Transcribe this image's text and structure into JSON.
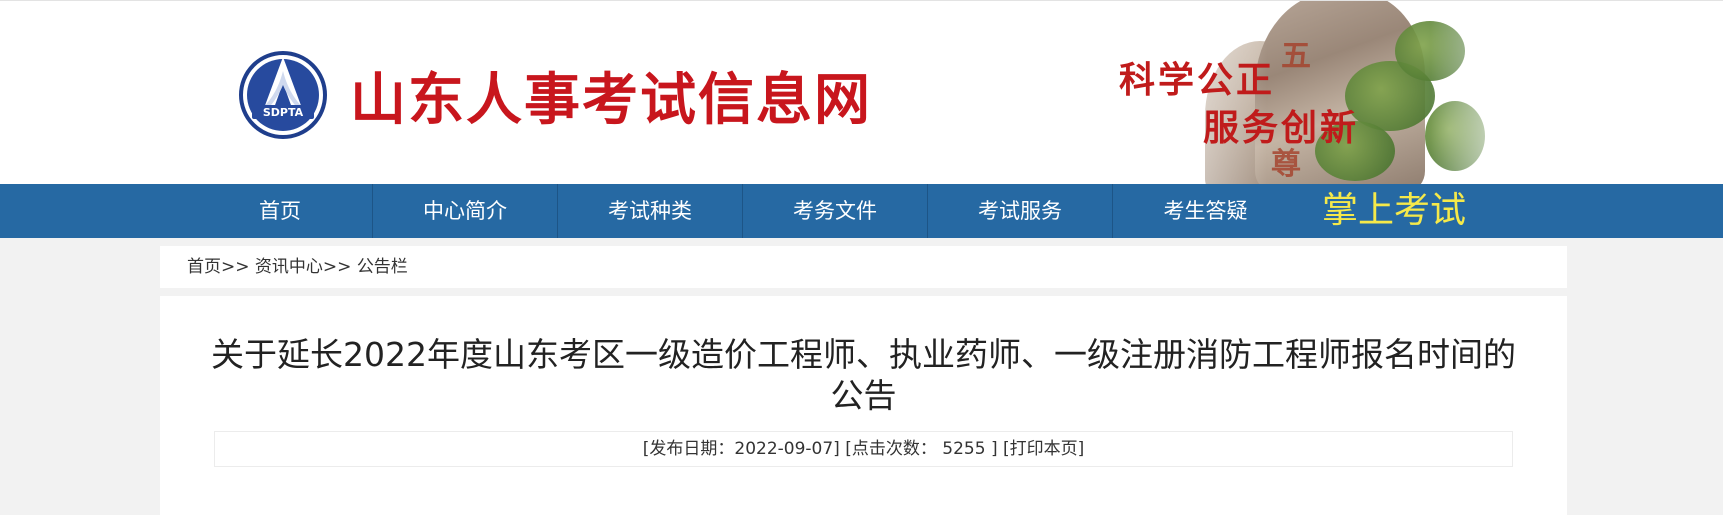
{
  "header": {
    "site_name": "山东人事考试信息网",
    "logo_text": "SDPTA",
    "slogan_line1": "科学公正",
    "slogan_line2": "服务创新",
    "brand_color": "#c8161d"
  },
  "nav": {
    "items": [
      "首页",
      "中心简介",
      "考试种类",
      "考务文件",
      "考试服务",
      "考生答疑"
    ],
    "special": "掌上考试",
    "bg_color": "#2669a3",
    "special_color": "#f5e94a"
  },
  "breadcrumb": {
    "home": "首页",
    "sep1": ">>",
    "section": "资讯中心",
    "sep2": ">>",
    "current": "公告栏"
  },
  "article": {
    "title": "关于延长2022年度山东考区一级造价工程师、执业药师、一级注册消防工程师报名时间的公告",
    "meta_date_label": "[发布日期：",
    "meta_date": "2022-09-07",
    "meta_date_close": "]",
    "meta_clicks_label": "[点击次数：",
    "meta_clicks": "5255",
    "meta_clicks_close": "]",
    "print_label": "[打印本页]"
  }
}
